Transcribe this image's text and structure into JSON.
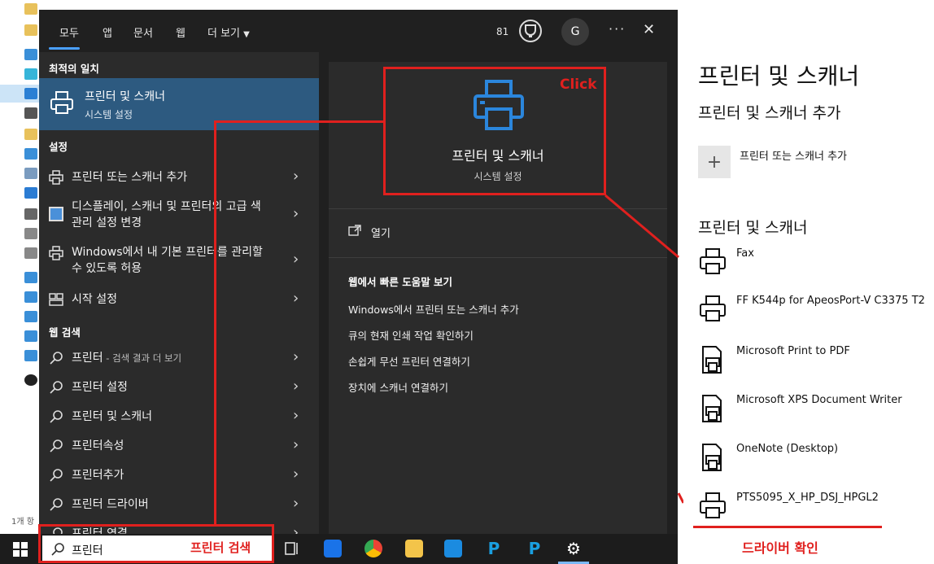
{
  "explorer": {
    "status": "1개 항"
  },
  "search_panel": {
    "tabs": [
      "모두",
      "앱",
      "문서",
      "웹",
      "더 보기"
    ],
    "points": "81",
    "avatar_letter": "G",
    "more_label": "···",
    "close_label": "✕",
    "best_match": {
      "section": "최적의 일치",
      "title": "프린터 및 스캐너",
      "subtitle": "시스템 설정"
    },
    "settings_section": "설정",
    "settings_items": [
      "프린터 또는 스캐너 추가",
      "디스플레이, 스캐너 및 프린터의 고급 색 관리 설정 변경",
      "Windows에서 내 기본 프린터를 관리할 수 있도록 허용",
      "시작 설정"
    ],
    "web_section": "웹 검색",
    "web_items": [
      {
        "text": "프린터",
        "suffix": " - 검색 결과 더 보기"
      },
      {
        "text": "프린터 설정",
        "suffix": ""
      },
      {
        "text": "프린터 및 스캐너",
        "suffix": ""
      },
      {
        "text": "프린터속성",
        "suffix": ""
      },
      {
        "text": "프린터추가",
        "suffix": ""
      },
      {
        "text": "프린터 드라이버",
        "suffix": ""
      },
      {
        "text": "프린터 연결",
        "suffix": ""
      }
    ],
    "preview": {
      "title": "프린터 및 스캐너",
      "subtitle": "시스템 설정",
      "open": "열기",
      "help_heading": "웹에서 빠른 도움말 보기",
      "links": [
        "Windows에서 프린터 또는 스캐너 추가",
        "큐의 현재 인쇄 작업 확인하기",
        "손쉽게 무선 프린터 연결하기",
        "장치에 스캐너 연결하기"
      ]
    }
  },
  "taskbar": {
    "search_value": "프린터"
  },
  "annotations": {
    "click": "Click",
    "search": "프린터 검색",
    "driver": "드라이버 확인",
    "color": "#e0201e"
  },
  "settings_page": {
    "title": "프린터 및 스캐너",
    "add_heading": "프린터 및 스캐너 추가",
    "add_label": "프린터 또는 스캐너 추가",
    "list_heading": "프린터 및 스캐너",
    "printers": [
      "Fax",
      "FF K544p for ApeosPort-V C3375 T2",
      "Microsoft Print to PDF",
      "Microsoft XPS Document Writer",
      "OneNote (Desktop)",
      "PTS5095_X_HP_DSJ_HPGL2"
    ]
  },
  "colors": {
    "accent": "#4aa0ff",
    "selected": "#2d5a80",
    "panel": "#202020"
  }
}
